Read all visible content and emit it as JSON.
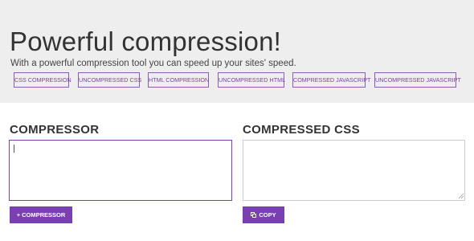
{
  "hero": {
    "title": "Powerful compression!",
    "subtitle": "With a powerful compression tool you can speed up your sites' speed."
  },
  "nav": {
    "links": [
      "CSS COMPRESSION",
      "UNCOMPRESSED CSS",
      "HTML COMPRESSION",
      "UNCOMPRESSED HTML",
      "COMPRESSED JAVASCRIPT",
      "UNCOMPRESSED JAVASCRIPT"
    ]
  },
  "input_panel": {
    "title": "COMPRESSOR",
    "value": "",
    "button_label": "COMPRESSOR",
    "button_icon": "plus-icon"
  },
  "output_panel": {
    "title": "COMPRESSED CSS",
    "value": "",
    "button_label": "COPY",
    "button_icon": "copy-icon"
  },
  "colors": {
    "accent": "#7a3fb0",
    "hero_background": "#eeeeee",
    "text": "#333333"
  }
}
